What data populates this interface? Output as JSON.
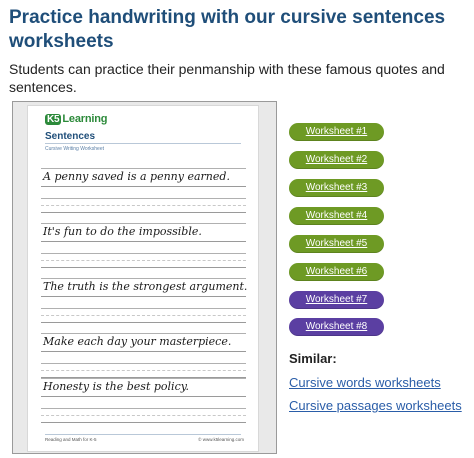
{
  "header": {
    "title": "Practice handwriting with our cursive sentences worksheets",
    "description": "Students can practice their penmanship with these famous quotes and sentences."
  },
  "preview": {
    "logo_mark": "K5",
    "logo_text": "Learning",
    "title": "Sentences",
    "subtitle": "Cursive Writing Worksheet",
    "sentences": [
      "A penny saved is a penny earned.",
      "It's fun to do the impossible.",
      "The truth is the strongest argument.",
      "Make each day your masterpiece.",
      "Honesty is the best policy."
    ],
    "footer_left": "Reading and Math for K-5",
    "footer_right": "© www.k5learning.com"
  },
  "worksheets": [
    {
      "label": "Worksheet #1",
      "color": "#6e9a24"
    },
    {
      "label": "Worksheet #2",
      "color": "#6e9a24"
    },
    {
      "label": "Worksheet #3",
      "color": "#6e9a24"
    },
    {
      "label": "Worksheet #4",
      "color": "#6e9a24"
    },
    {
      "label": "Worksheet #5",
      "color": "#6e9a24"
    },
    {
      "label": "Worksheet #6",
      "color": "#6e9a24"
    },
    {
      "label": "Worksheet #7",
      "color": "#5b3fa2"
    },
    {
      "label": "Worksheet #8",
      "color": "#5b3fa2"
    }
  ],
  "similar": {
    "heading": "Similar:",
    "links": [
      "Cursive words worksheets",
      "Cursive passages worksheets"
    ]
  },
  "colors": {
    "title": "#1f4e79",
    "link": "#2a5da8",
    "green_button": "#6e9a24",
    "purple_button": "#5b3fa2"
  }
}
